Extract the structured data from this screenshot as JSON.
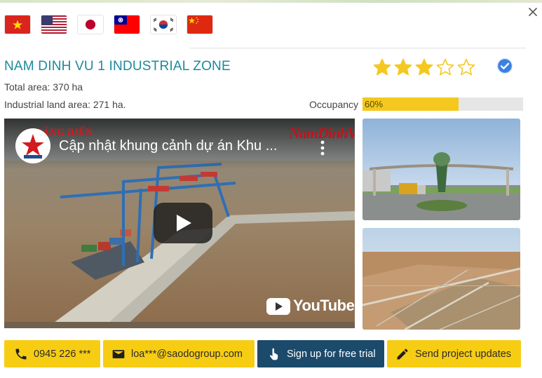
{
  "flags": [
    {
      "country": "Vietnam",
      "icon": "vietnam-flag-icon"
    },
    {
      "country": "United States",
      "icon": "usa-flag-icon"
    },
    {
      "country": "Japan",
      "icon": "japan-flag-icon"
    },
    {
      "country": "Taiwan",
      "icon": "taiwan-flag-icon"
    },
    {
      "country": "South Korea",
      "icon": "south-korea-flag-icon"
    },
    {
      "country": "China",
      "icon": "china-flag-icon"
    }
  ],
  "zone": {
    "name": "NAM DINH VU 1 INDUSTRIAL ZONE",
    "rating": 3,
    "rating_max": 5,
    "total_area": "Total area: 370 ha",
    "industrial_land_area": "Industrial land area: 271 ha.",
    "occupancy_label": "Occupancy",
    "occupancy_value": "60%",
    "occupancy_fraction": 0.6
  },
  "video": {
    "title": "Cập nhật khung cảnh dự án Khu ...",
    "channel_brand": "NamDinhVu",
    "channel_sub": "CẢNG BIỂN",
    "platform": "YouTube"
  },
  "actions": {
    "phone": "0945 226 ***",
    "email": "loa***@saodogroup.com",
    "trial": "Sign up for free trial",
    "updates": "Send project updates"
  },
  "colors": {
    "title": "#1b8a9a",
    "accent_yellow": "#f7cd14",
    "button_blue": "#1b4a6b",
    "star": "#f4c81f",
    "verified": "#3b82e0"
  }
}
